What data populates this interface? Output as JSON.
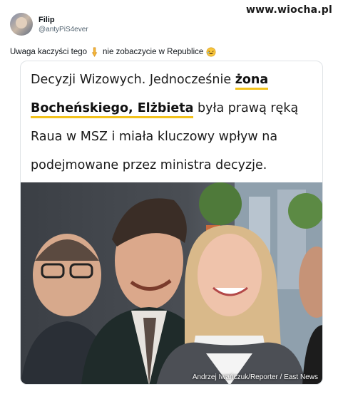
{
  "watermark": "www.wiocha.pl",
  "tweet": {
    "display_name": "Filip",
    "handle": "@antyPiS4ever",
    "text_before": "Uwaga kaczyści tego",
    "text_after": "nie zobaczycie w Republice",
    "emoji_1": "pointing-down-emoji",
    "emoji_2": "rolling-laughing-emoji"
  },
  "quote": {
    "l1_a": "Decyzji Wizowych. Jednocześnie ",
    "l1_b": "żona",
    "l2_a": "Bocheńskiego, Elżbieta",
    "l2_b": " była prawą ręką",
    "l3": "Raua w MSZ i miała kluczowy wpływ na",
    "l4": "podejmowane przez ministra decyzje."
  },
  "photo": {
    "credit": "Andrzej Iwańczuk/Reporter / East News"
  },
  "colors": {
    "highlight": "#f2c21b",
    "handle": "#536471"
  }
}
